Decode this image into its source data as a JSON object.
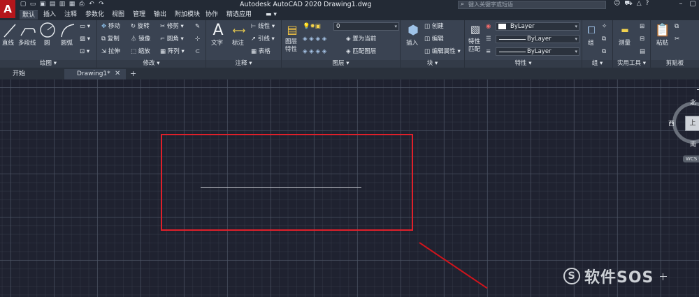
{
  "app": {
    "logo_letter": "A",
    "title": "Autodesk AutoCAD 2020    Drawing1.dwg",
    "search_placeholder": "键入关键字或短语"
  },
  "menu_tabs": [
    {
      "label": "默认",
      "active": true
    },
    {
      "label": "插入"
    },
    {
      "label": "注释"
    },
    {
      "label": "参数化"
    },
    {
      "label": "视图"
    },
    {
      "label": "管理"
    },
    {
      "label": "输出"
    },
    {
      "label": "附加模块"
    },
    {
      "label": "协作"
    },
    {
      "label": "精选应用"
    }
  ],
  "ribbon": {
    "draw": {
      "title": "绘图 ▾",
      "line": "直线",
      "polyline": "多段线",
      "circle": "圆",
      "arc": "圆弧"
    },
    "modify": {
      "title": "修改 ▾",
      "move": "移动",
      "rotate": "旋转",
      "trim": "修剪",
      "copy": "复制",
      "mirror": "镜像",
      "fillet": "圆角",
      "stretch": "拉伸",
      "scale": "缩放",
      "array": "阵列"
    },
    "annotation": {
      "title": "注释 ▾",
      "text": "文字",
      "dimension": "标注",
      "linear": "线性",
      "leader": "引线",
      "table": "表格"
    },
    "layers": {
      "title": "图层 ▾",
      "layer_properties": "图层\n特性",
      "layer_select": "0",
      "make_current": "置为当前",
      "match_layer": "匹配图层"
    },
    "block": {
      "title": "块 ▾",
      "insert": "插入",
      "create": "创建",
      "edit": "编辑",
      "edit_attributes": "编辑属性"
    },
    "properties": {
      "title": "特性 ▾",
      "match": "特性\n匹配",
      "color": "ByLayer",
      "linetype": "ByLayer",
      "lineweight": "ByLayer"
    },
    "groups": {
      "title": "组 ▾",
      "group": "组"
    },
    "utilities": {
      "title": "实用工具 ▾",
      "measure": "测量"
    },
    "clipboard": {
      "title": "剪贴板",
      "paste": "粘贴"
    }
  },
  "file_tabs": [
    {
      "label": "开始"
    },
    {
      "label": "Drawing1*",
      "active": true
    }
  ],
  "viewcube": {
    "north": "北",
    "west": "西",
    "south": "南",
    "face": "上",
    "wcs": "WCS ▾"
  },
  "watermark": {
    "text": "软件SOS"
  },
  "colors": {
    "highlight": "#e0202a",
    "brand_red": "#b5161b",
    "ribbon_bg": "#3a4352",
    "canvas_bg": "#1f2230"
  }
}
